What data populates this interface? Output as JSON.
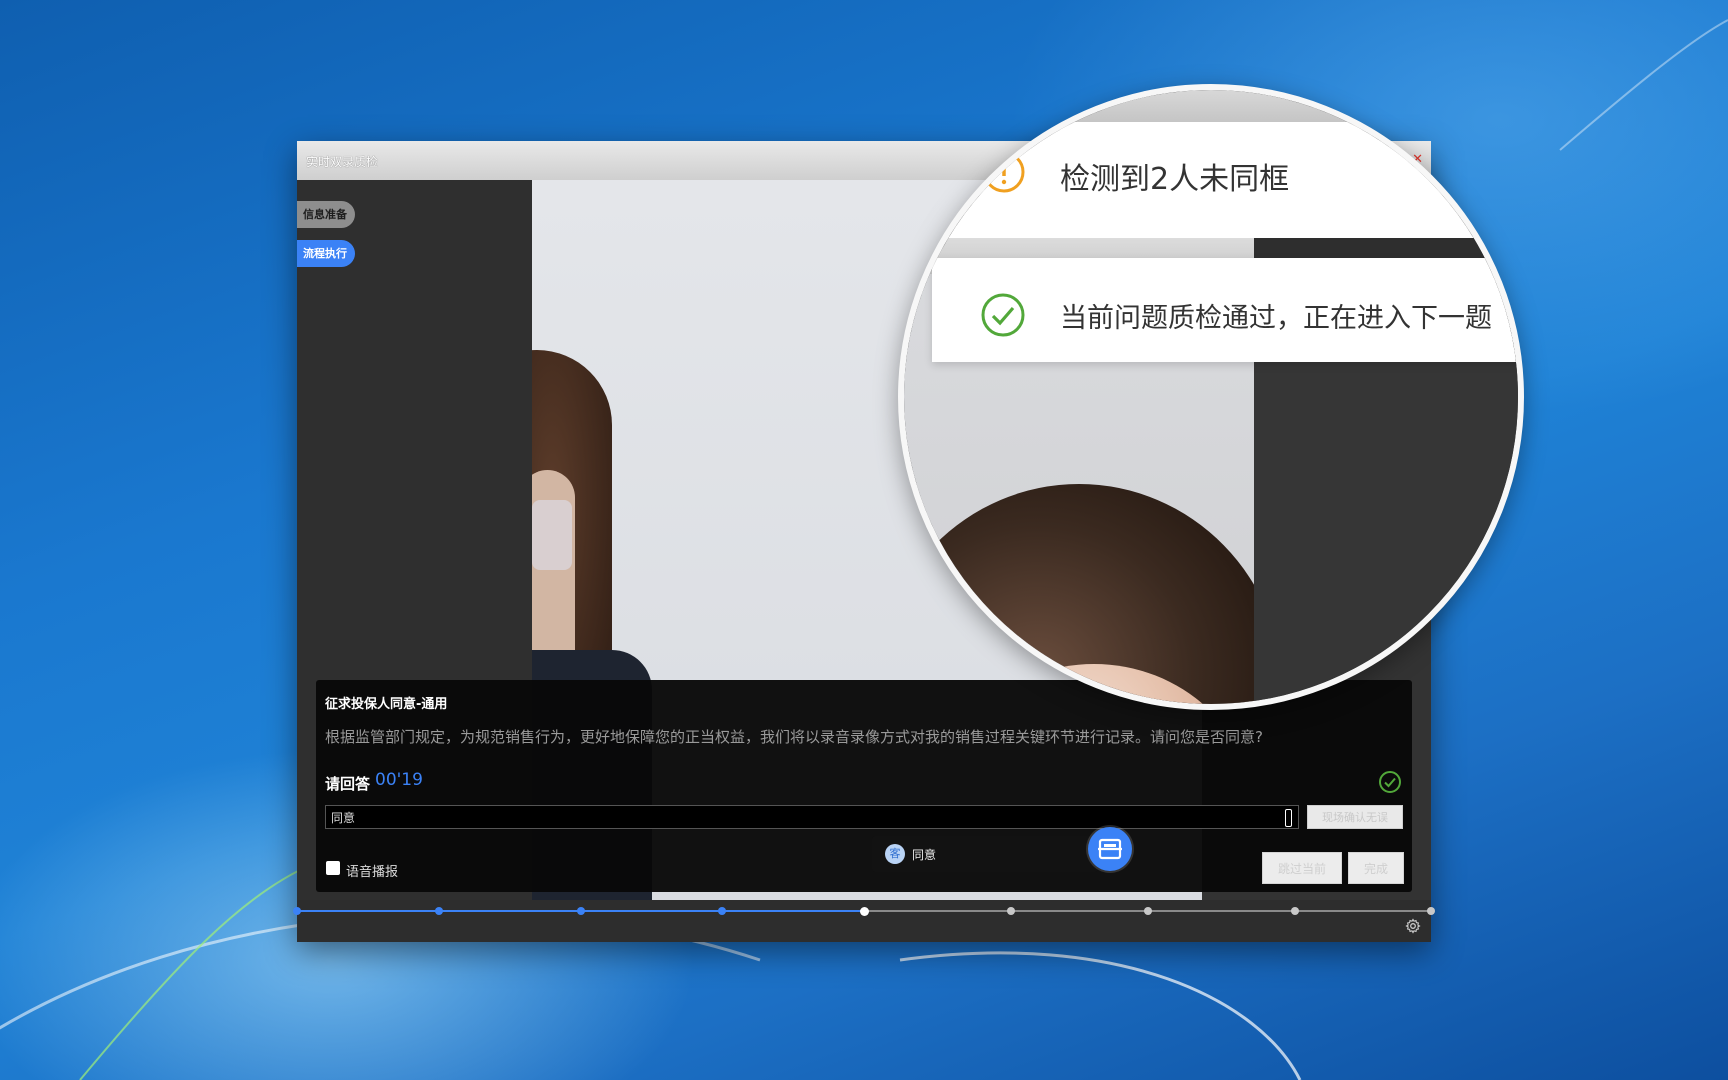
{
  "window": {
    "title": "实时双录质检"
  },
  "sidebar": {
    "items": [
      {
        "label": "信息准备"
      },
      {
        "label": "流程执行"
      }
    ]
  },
  "question": {
    "title": "征求投保人同意-通用",
    "text": "根据监管部门规定，为规范销售行为，更好地保障您的正当权益，我们将以录音录像方式对我的销售过程关键环节进行记录。请问您是否同意?"
  },
  "answer": {
    "label": "请回答",
    "timer": "00'19",
    "input_value": "同意",
    "confirm_button": "现场确认无误"
  },
  "options": {
    "voice_broadcast_label": "语音播报"
  },
  "transcript_chip": {
    "avatar_text": "客",
    "text": "同意"
  },
  "actions": {
    "skip_label": "跳过当前",
    "done_label": "完成"
  },
  "magnifier": {
    "warning_text": "检测到2人未同框",
    "pass_text": "当前问题质检通过，正在进入下一题"
  },
  "progress": {
    "completed_fraction": 0.5
  },
  "colors": {
    "accent": "#3b82f6",
    "success": "#52a83a",
    "warning": "#f0a020",
    "close": "#e0342b"
  },
  "icons": [
    "settings-gear-icon",
    "check-circle-icon",
    "warning-circle-icon",
    "scan-icon"
  ]
}
